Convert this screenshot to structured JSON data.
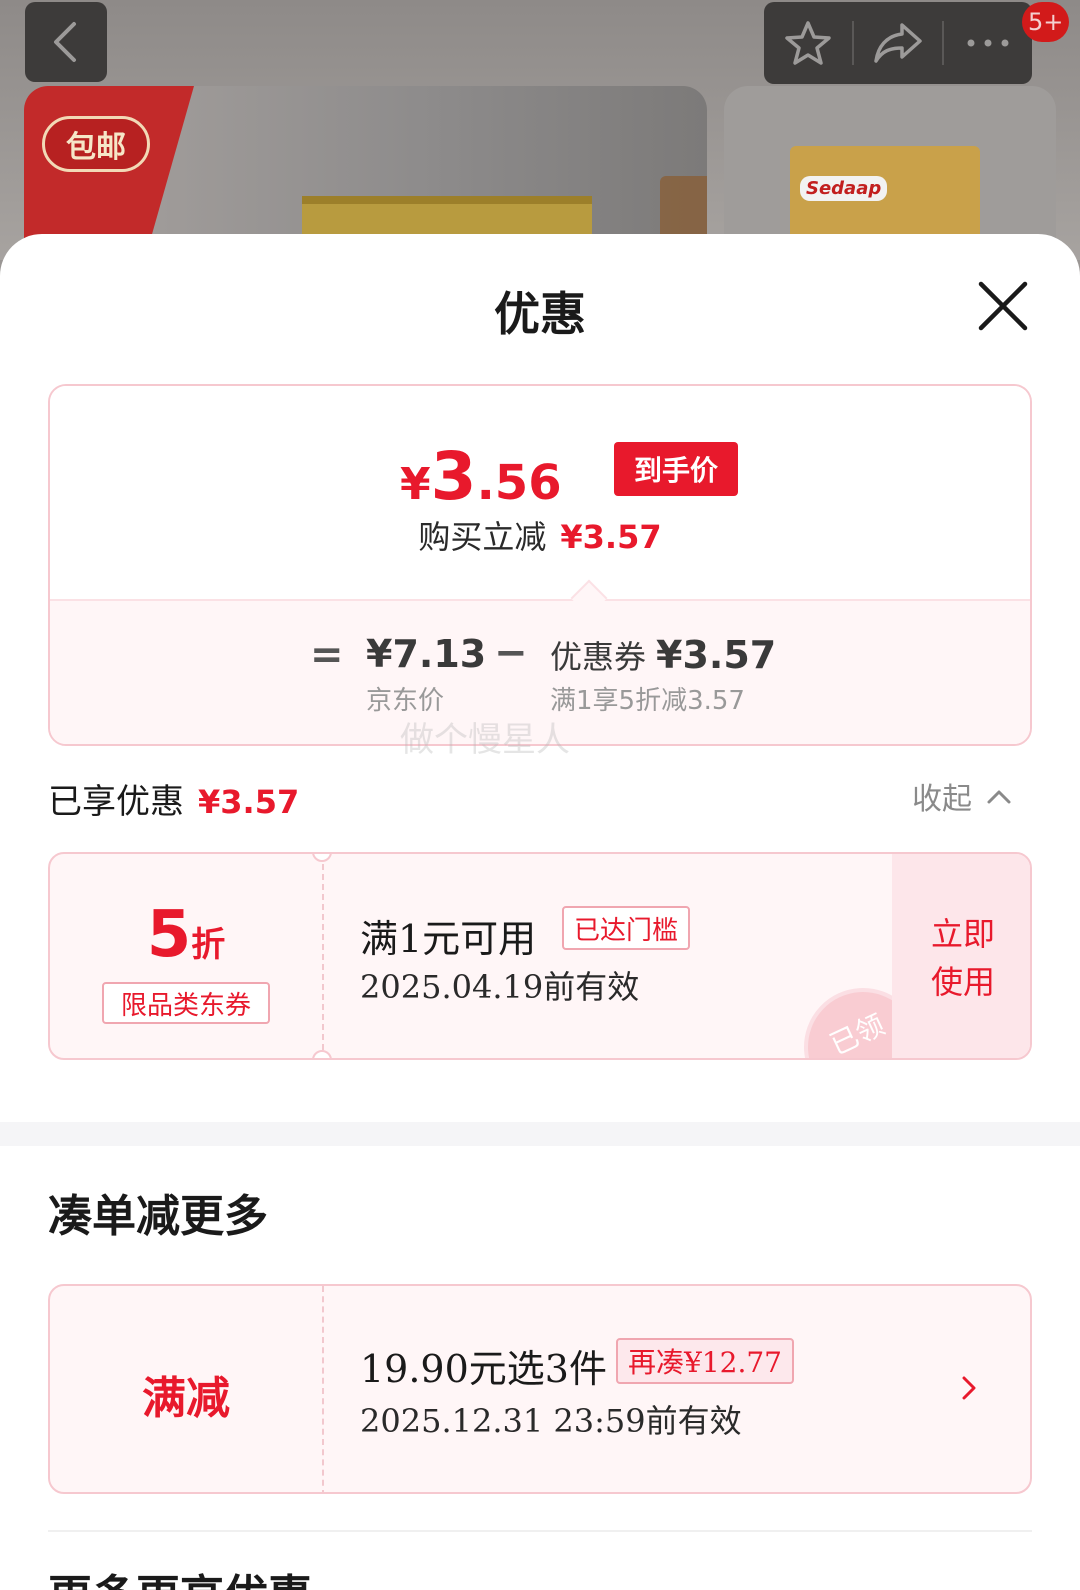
{
  "topbar": {
    "badge_count": "5+",
    "icons": [
      "back-icon",
      "star-icon",
      "share-icon",
      "more-icon"
    ]
  },
  "background": {
    "logo_text": "包邮",
    "package_brand": "Sedaap"
  },
  "sheet": {
    "title": "优惠"
  },
  "price": {
    "yen": "¥",
    "integer": "3",
    "decimal": ".56",
    "tag": "到手价",
    "instant_label": "购买立减",
    "instant_amount": "¥3.57"
  },
  "formula": {
    "equals": "=",
    "jd_price": "¥7.13",
    "jd_label": "京东价",
    "minus": "−",
    "coupon_name": "优惠券",
    "coupon_value": "¥3.57",
    "coupon_rule": "满1享5折减3.57"
  },
  "watermark": "做个慢星人",
  "enjoyed": {
    "label": "已享优惠",
    "amount": "¥3.57",
    "collapse": "收起"
  },
  "coupon": {
    "discount_num": "5",
    "discount_unit": "折",
    "type": "限品类东券",
    "condition": "满1元可用",
    "met_tag": "已达门槛",
    "valid": "2025.04.19前有效",
    "action": "立即使用",
    "stamp": "已领"
  },
  "more": {
    "title": "凑单减更多"
  },
  "promo": {
    "type": "满减",
    "condition": "19.90元选3件",
    "need_tag": "再凑¥12.77",
    "valid": "2025.12.31 23:59前有效"
  },
  "next_section": {
    "title": "更多更高优惠"
  },
  "colors": {
    "accent": "#e8192c",
    "card_bg": "#fff6f7",
    "card_border": "#f6c8cf"
  }
}
